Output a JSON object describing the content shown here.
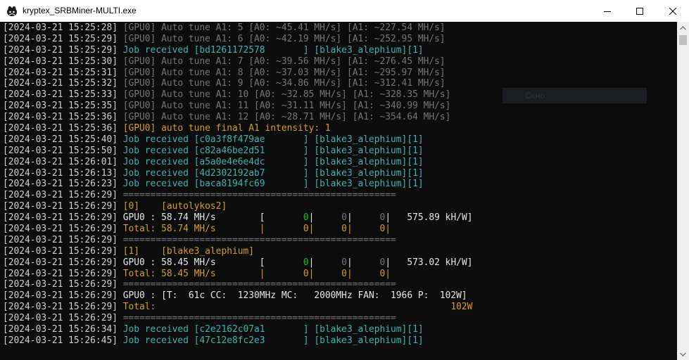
{
  "window": {
    "title": "kryptex_SRBMiner-MULTI.exe",
    "controls": [
      "minimize-icon",
      "maximize-icon",
      "close-icon"
    ]
  },
  "overlay": {
    "label": "Окно"
  },
  "console_lines": [
    [
      {
        "t": "[2024-03-21 15:25:28] ",
        "c": "ts"
      },
      {
        "t": "[GPU0] Auto tune A1: 5 [A0: ~45.41 MH/s] [A1: ~227.54 MH/s]",
        "c": "gray"
      }
    ],
    [
      {
        "t": "[2024-03-21 15:25:29] ",
        "c": "ts"
      },
      {
        "t": "[GPU0] Auto tune A1: 6 [A0: ~42.19 MH/s] [A1: ~252.95 MH/s]",
        "c": "gray"
      }
    ],
    [
      {
        "t": "[2024-03-21 15:25:29] ",
        "c": "ts"
      },
      {
        "t": "Job received [bd1261172578       ] [blake3_alephium][1]",
        "c": "cyan"
      }
    ],
    [
      {
        "t": "[2024-03-21 15:25:30] ",
        "c": "ts"
      },
      {
        "t": "[GPU0] Auto tune A1: 7 [A0: ~39.56 MH/s] [A1: ~276.45 MH/s]",
        "c": "gray"
      }
    ],
    [
      {
        "t": "[2024-03-21 15:25:31] ",
        "c": "ts"
      },
      {
        "t": "[GPU0] Auto tune A1: 8 [A0: ~37.03 MH/s] [A1: ~295.97 MH/s]",
        "c": "gray"
      }
    ],
    [
      {
        "t": "[2024-03-21 15:25:32] ",
        "c": "ts"
      },
      {
        "t": "[GPU0] Auto tune A1: 9 [A0: ~34.86 MH/s] [A1: ~312.41 MH/s]",
        "c": "gray"
      }
    ],
    [
      {
        "t": "[2024-03-21 15:25:33] ",
        "c": "ts"
      },
      {
        "t": "[GPU0] Auto tune A1: 10 [A0: ~32.85 MH/s] [A1: ~328.35 MH/s]",
        "c": "gray"
      }
    ],
    [
      {
        "t": "[2024-03-21 15:25:35] ",
        "c": "ts"
      },
      {
        "t": "[GPU0] Auto tune A1: 11 [A0: ~31.11 MH/s] [A1: ~340.99 MH/s]",
        "c": "gray"
      }
    ],
    [
      {
        "t": "[2024-03-21 15:25:36] ",
        "c": "ts"
      },
      {
        "t": "[GPU0] Auto tune A1: 12 [A0: ~28.71 MH/s] [A1: ~354.64 MH/s]",
        "c": "gray"
      }
    ],
    [
      {
        "t": "[2024-03-21 15:25:36] ",
        "c": "ts"
      },
      {
        "t": "[GPU0] auto tune final A1 intensity: 1",
        "c": "yel"
      }
    ],
    [
      {
        "t": "[2024-03-21 15:25:40] ",
        "c": "ts"
      },
      {
        "t": "Job received [c0a3f8f479ae       ] [blake3_alephium][1]",
        "c": "cyan"
      }
    ],
    [
      {
        "t": "[2024-03-21 15:25:50] ",
        "c": "ts"
      },
      {
        "t": "Job received [c82a46be2d51       ] [blake3_alephium][1]",
        "c": "cyan"
      }
    ],
    [
      {
        "t": "[2024-03-21 15:26:01] ",
        "c": "ts"
      },
      {
        "t": "Job received [a5a0e4e6e4dc       ] [blake3_alephium][1]",
        "c": "cyan"
      }
    ],
    [
      {
        "t": "[2024-03-21 15:26:13] ",
        "c": "ts"
      },
      {
        "t": "Job received [4d2302192ab7       ] [blake3_alephium][1]",
        "c": "cyan"
      }
    ],
    [
      {
        "t": "[2024-03-21 15:26:23] ",
        "c": "ts"
      },
      {
        "t": "Job received [baca8194fc69       ] [blake3_alephium][1]",
        "c": "cyan"
      }
    ],
    [
      {
        "t": "[2024-03-21 15:26:29] ",
        "c": "ts"
      },
      {
        "t": "==================================================",
        "c": "dim"
      }
    ],
    [
      {
        "t": "[2024-03-21 15:26:29] ",
        "c": "ts"
      },
      {
        "t": "[0]    [autolykos2]",
        "c": "yel"
      }
    ],
    [
      {
        "t": "[2024-03-21 15:26:29] ",
        "c": "ts"
      },
      {
        "t": "GPU0 : 58.74 MH/s        [       ",
        "c": "wh"
      },
      {
        "t": "0",
        "c": "grn"
      },
      {
        "t": "|     ",
        "c": "wh"
      },
      {
        "t": "0",
        "c": "dim"
      },
      {
        "t": "|     ",
        "c": "wh"
      },
      {
        "t": "0",
        "c": "dim"
      },
      {
        "t": "|   575.89 kH/W]",
        "c": "wh"
      }
    ],
    [
      {
        "t": "[2024-03-21 15:26:29] ",
        "c": "ts"
      },
      {
        "t": "Total: 58.74 MH/s        |       0|     0|     0|",
        "c": "yel"
      }
    ],
    [
      {
        "t": "[2024-03-21 15:26:29] ",
        "c": "ts"
      },
      {
        "t": "==================================================",
        "c": "dim"
      }
    ],
    [
      {
        "t": "[2024-03-21 15:26:29] ",
        "c": "ts"
      },
      {
        "t": "[1]    [blake3_alephium]",
        "c": "yel"
      }
    ],
    [
      {
        "t": "[2024-03-21 15:26:29] ",
        "c": "ts"
      },
      {
        "t": "GPU0 : 58.45 MH/s        [       ",
        "c": "wh"
      },
      {
        "t": "0",
        "c": "grn"
      },
      {
        "t": "|     ",
        "c": "wh"
      },
      {
        "t": "0",
        "c": "dim"
      },
      {
        "t": "|     ",
        "c": "wh"
      },
      {
        "t": "0",
        "c": "dim"
      },
      {
        "t": "|   573.02 kH/W]",
        "c": "wh"
      }
    ],
    [
      {
        "t": "[2024-03-21 15:26:29] ",
        "c": "ts"
      },
      {
        "t": "Total: 58.45 MH/s        |       0|     0|     0|",
        "c": "yel"
      }
    ],
    [
      {
        "t": "[2024-03-21 15:26:29] ",
        "c": "ts"
      },
      {
        "t": "==================================================",
        "c": "dim"
      }
    ],
    [
      {
        "t": "[2024-03-21 15:26:29] ",
        "c": "ts"
      },
      {
        "t": "GPU0 : [T:  61c CC:  1230MHz MC:   2000MHz FAN:  1966 P:  102W]",
        "c": "wh"
      }
    ],
    [
      {
        "t": "[2024-03-21 15:26:29] ",
        "c": "ts"
      },
      {
        "t": "Total:                                                      102W",
        "c": "yel"
      }
    ],
    [
      {
        "t": "[2024-03-21 15:26:29] ",
        "c": "ts"
      },
      {
        "t": "==================================================",
        "c": "dim"
      }
    ],
    [
      {
        "t": "[2024-03-21 15:26:34] ",
        "c": "ts"
      },
      {
        "t": "Job received [c2e2162c07a1       ] [blake3_alephium][1]",
        "c": "cyan"
      }
    ],
    [
      {
        "t": "[2024-03-21 15:26:45] ",
        "c": "ts"
      },
      {
        "t": "Job received [47c12e8fc2e3       ] [blake3_alephium][1]",
        "c": "cyan"
      }
    ]
  ]
}
